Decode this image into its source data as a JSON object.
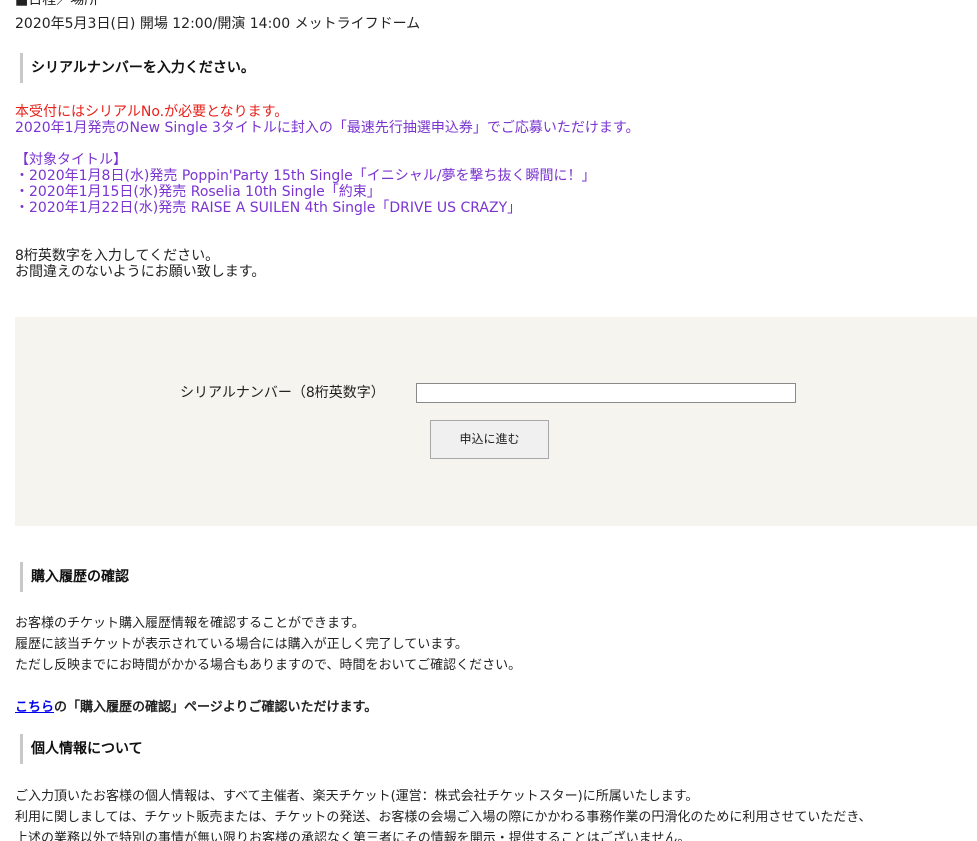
{
  "event": {
    "schedule_header": "■日程／場所",
    "schedule_line": "2020年5月3日(日) 開場 12:00/開演 14:00 メットライフドーム"
  },
  "serial_section": {
    "heading": "シリアルナンバーを入力ください。",
    "notice_red": "本受付にはシリアルNo.が必要となります。",
    "notice_purple": "2020年1月発売のNew Single 3タイトルに封入の「最速先行抽選申込券」でご応募いただけます。",
    "titles_header": "【対象タイトル】",
    "titles": [
      "・2020年1月8日(水)発売 Poppin'Party 15th Single「イニシャル/夢を撃ち抜く瞬間に！」",
      "・2020年1月15日(水)発売 Roselia 10th Single「約束」",
      "・2020年1月22日(水)発売 RAISE A SUILEN 4th Single「DRIVE US CRAZY」"
    ],
    "instruction_1": "8桁英数字を入力してください。",
    "instruction_2": "お間違えのないようにお願い致します。"
  },
  "form": {
    "serial_label": "シリアルナンバー（8桁英数字）",
    "serial_value": "",
    "submit_label": "申込に進む"
  },
  "history_section": {
    "heading": "購入履歴の確認",
    "lines": [
      "お客様のチケット購入履歴情報を確認することができます。",
      "履歴に該当チケットが表示されている場合には購入が正しく完了しています。",
      "ただし反映までにお時間がかかる場合もありますので、時間をおいてご確認ください。"
    ],
    "link_text": "こちら",
    "link_suffix": "の「購入履歴の確認」ページよりご確認いただけます。"
  },
  "privacy_section": {
    "heading": "個人情報について",
    "lines": [
      "ご入力頂いたお客様の個人情報は、すべて主催者、楽天チケット(運営：株式会社チケットスター)に所属いたします。",
      "利用に関しましては、チケット販売または、チケットの発送、お客様の会場ご入場の際にかかわる事務作業の円滑化のために利用させていただき、",
      "上述の業務以外で特別の事情が無い限りお客様の承認なく第三者にその情報を開示・提供することはございません。"
    ]
  },
  "colors": {
    "notice_red": "#e8201a",
    "notice_purple": "#7b34d0",
    "form_background": "#f5f4ee",
    "link": "#0000ee"
  }
}
